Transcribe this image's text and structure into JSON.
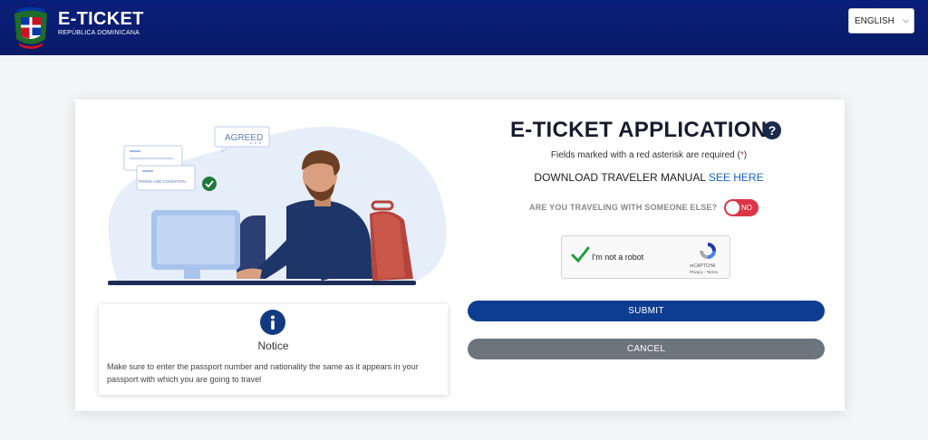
{
  "header": {
    "brand_title": "E-TICKET",
    "brand_subtitle": "REPÚBLICA DOMINICANA",
    "language_selected": "ENGLISH"
  },
  "illustration": {
    "badge_agreed": "AGREED",
    "doc_label": "TERMS AND CONDITION"
  },
  "notice": {
    "title": "Notice",
    "text": "Make sure to enter the passport number and nationality the same as it appears in your passport with which you are going to travel"
  },
  "form": {
    "title": "E-TICKET APPLICATION",
    "required_prefix": "Fields marked with a red asterisk are required (",
    "required_asterisk": "*",
    "required_suffix": ")",
    "manual_label": "DOWNLOAD TRAVELER MANUAL",
    "manual_link": "SEE HERE",
    "traveling_question": "ARE YOU TRAVELING WITH SOMEONE ELSE?",
    "toggle_value": "NO",
    "captcha_text": "I'm not a robot",
    "captcha_brand": "reCAPTCHA",
    "captcha_links": "Privacy - Terms",
    "submit_label": "SUBMIT",
    "cancel_label": "CANCEL"
  },
  "colors": {
    "header": "#0a1f7a",
    "submit": "#0d3d91",
    "cancel": "#6c757d",
    "toggle": "#dc3545",
    "link": "#1565c0"
  }
}
